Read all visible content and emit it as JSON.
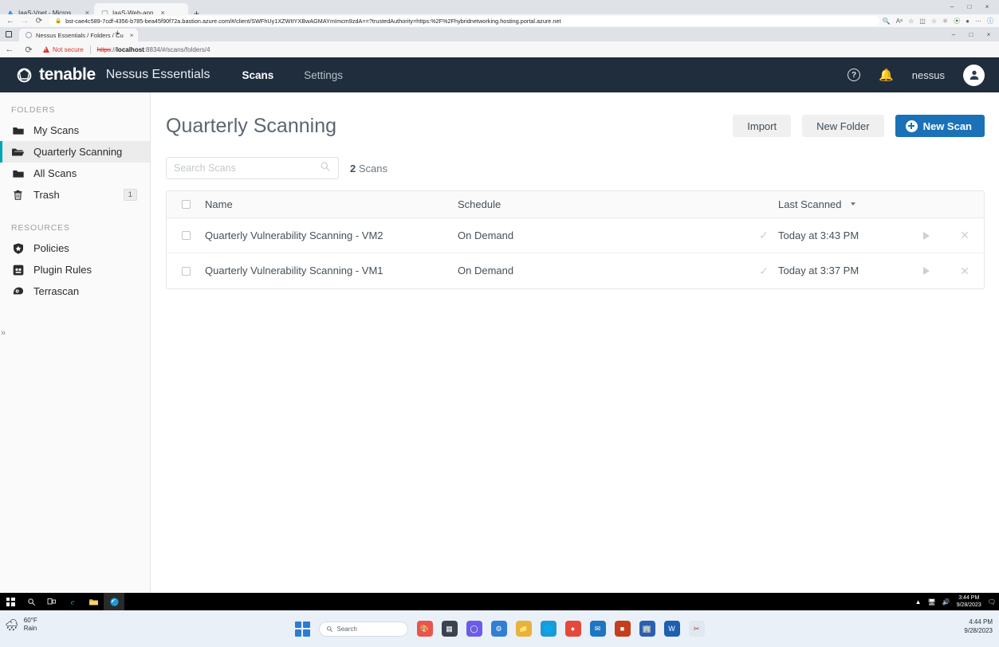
{
  "outer_browser": {
    "tabs": [
      {
        "title": "IaaS-Vnet - Microsoft Azure",
        "favicon": "azure-icon",
        "active": false,
        "close": "×"
      },
      {
        "title": "IaaS-Web-app",
        "favicon": "page-icon",
        "active": true,
        "close": "×"
      }
    ],
    "new_tab_label": "+",
    "nav": {
      "back": "←",
      "forward": "→",
      "reload": "⟳"
    },
    "url": {
      "lock_icon": "lock-icon",
      "text": "bst-cae4c589-7cdf-4356-b785-bea45f90f72a.bastion.azure.com/#/client/SWFhUy1XZWItYXBwAGMAYmImcm9zdA==?trustedAuthority=https:%2F%2Fhybridnetworking.hosting.portal.azure.net"
    },
    "toolbar_icons": [
      "zoom-icon",
      "read-aloud-icon",
      "favorite-star-icon",
      "split-screen-icon",
      "collections-icon",
      "browser-essentials-icon",
      "extensions-icon",
      "profile-icon",
      "settings-more-icon",
      "copilot-icon"
    ],
    "window_controls": {
      "minimize": "–",
      "maximize": "□",
      "close": "×"
    }
  },
  "vm_browser": {
    "tab": {
      "title": "Nessus Essentials / Folders / Cu",
      "favicon": "loading-circle-icon",
      "close": "×"
    },
    "new_tab_label": "+",
    "nav": {
      "back": "←",
      "reload": "⟳"
    },
    "security_label": "Not secure",
    "url": {
      "scheme": "https",
      "separator": "://",
      "host": "localhost",
      "port": ":8834",
      "path": "/#/scans/folders/4"
    },
    "window_controls": {
      "minimize": "–",
      "maximize": "□",
      "close": "×"
    }
  },
  "nessus": {
    "brand": {
      "name": "tenable",
      "product": "Nessus Essentials",
      "logo_icon": "tenable-logo-icon"
    },
    "nav_links": [
      {
        "label": "Scans",
        "active": true
      },
      {
        "label": "Settings",
        "active": false
      }
    ],
    "top_right": {
      "help_icon": "help-question-icon",
      "help_label": "?",
      "bell_icon": "notification-bell-icon",
      "username": "nessus",
      "avatar_icon": "user-avatar-icon"
    },
    "sidebar": {
      "folders_heading": "FOLDERS",
      "folders": [
        {
          "label": "My Scans",
          "icon": "folder-icon",
          "active": false,
          "badge": ""
        },
        {
          "label": "Quarterly Scanning",
          "icon": "folder-open-icon",
          "active": true,
          "badge": ""
        },
        {
          "label": "All Scans",
          "icon": "folder-icon",
          "active": false,
          "badge": ""
        },
        {
          "label": "Trash",
          "icon": "trash-icon",
          "active": false,
          "badge": "1"
        }
      ],
      "resources_heading": "RESOURCES",
      "resources": [
        {
          "label": "Policies",
          "icon": "shield-star-icon"
        },
        {
          "label": "Plugin Rules",
          "icon": "plugin-rules-icon"
        },
        {
          "label": "Terrascan",
          "icon": "terrascan-icon"
        }
      ],
      "collapse_label": "«",
      "expand_label": "»"
    },
    "page": {
      "title": "Quarterly Scanning",
      "actions": [
        {
          "label": "Import",
          "style": "gray",
          "icon": ""
        },
        {
          "label": "New Folder",
          "style": "gray",
          "icon": ""
        },
        {
          "label": "New Scan",
          "style": "blue",
          "icon": "plus-circle-icon"
        }
      ],
      "search": {
        "placeholder": "Search Scans",
        "value": "",
        "icon": "search-icon"
      },
      "scan_count_number": "2",
      "scan_count_label": "Scans",
      "table": {
        "columns": [
          "Name",
          "Schedule",
          "Last Scanned"
        ],
        "sort_column": "Last Scanned",
        "sort_caret": "▼",
        "rows": [
          {
            "name": "Quarterly Vulnerability Scanning - VM2",
            "schedule": "On Demand",
            "status_icon": "check-icon",
            "last_scanned": "Today at 3:43 PM",
            "launch_icon": "play-icon",
            "delete_icon": "close-x-icon"
          },
          {
            "name": "Quarterly Vulnerability Scanning - VM1",
            "schedule": "On Demand",
            "status_icon": "check-icon",
            "last_scanned": "Today at 3:37 PM",
            "launch_icon": "play-icon",
            "delete_icon": "close-x-icon"
          }
        ]
      }
    },
    "colors": {
      "accent_blue": "#1a71b8",
      "nav_dark": "#1f2d3d",
      "active_teal": "#00a4b7"
    }
  },
  "vm_taskbar": {
    "items": [
      {
        "icon": "windows-start-icon",
        "selected": false
      },
      {
        "icon": "search-icon",
        "selected": false
      },
      {
        "icon": "task-view-icon",
        "selected": false
      },
      {
        "icon": "internet-explorer-icon",
        "selected": false
      },
      {
        "icon": "file-explorer-icon",
        "selected": false
      },
      {
        "icon": "microsoft-edge-icon",
        "selected": true
      }
    ],
    "tray": {
      "chevron": "⌃",
      "network_icon": "network-icon",
      "volume_icon": "volume-muted-icon",
      "action-center": "action-center-icon"
    },
    "time": "3:44 PM",
    "date": "9/28/2023"
  },
  "host_taskbar": {
    "weather": {
      "temperature": "60°F",
      "condition": "Rain",
      "icon": "rain-cloud-icon"
    },
    "start_icon": "windows-11-start-icon",
    "search_placeholder": "Search",
    "apps": [
      "paint-icon",
      "calculator-icon",
      "teams-icon",
      "settings-icon",
      "file-explorer-icon",
      "edge-icon",
      "chrome-icon",
      "outlook-icon",
      "office-icon",
      "store-icon",
      "word-icon",
      "snipping-tool-icon"
    ],
    "time": "4:44 PM",
    "date": "9/28/2023"
  }
}
